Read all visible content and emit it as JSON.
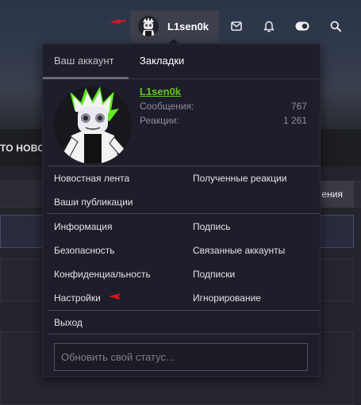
{
  "page": {
    "section_title": "ТО НОВО",
    "side_button_label": "ения"
  },
  "nav": {
    "username": "L1sen0k",
    "icons": [
      "mail-icon",
      "bell-icon",
      "theme-toggle-icon",
      "search-icon"
    ],
    "arrow_color": "#e0161b"
  },
  "menu": {
    "tabs": [
      {
        "label": "Ваш аккаунт",
        "active": true
      },
      {
        "label": "Закладки",
        "active": false
      }
    ],
    "profile": {
      "name": "L1sen0k",
      "name_color": "#62c51b",
      "stats": [
        {
          "label": "Сообщения:",
          "value": "767"
        },
        {
          "label": "Реакции:",
          "value": "1 261"
        }
      ]
    },
    "links_group1": {
      "left": [
        "Новостная лента",
        "Ваши публикации"
      ],
      "right": [
        "Полученные реакции"
      ]
    },
    "links_group2": {
      "left": [
        "Информация",
        "Безопасность",
        "Конфиденциальность",
        "Настройки"
      ],
      "right": [
        "Подпись",
        "Связанные аккаунты",
        "Подписки",
        "Игнорирование"
      ]
    },
    "logout": "Выход",
    "status_placeholder": "Обновить свой статус..."
  }
}
